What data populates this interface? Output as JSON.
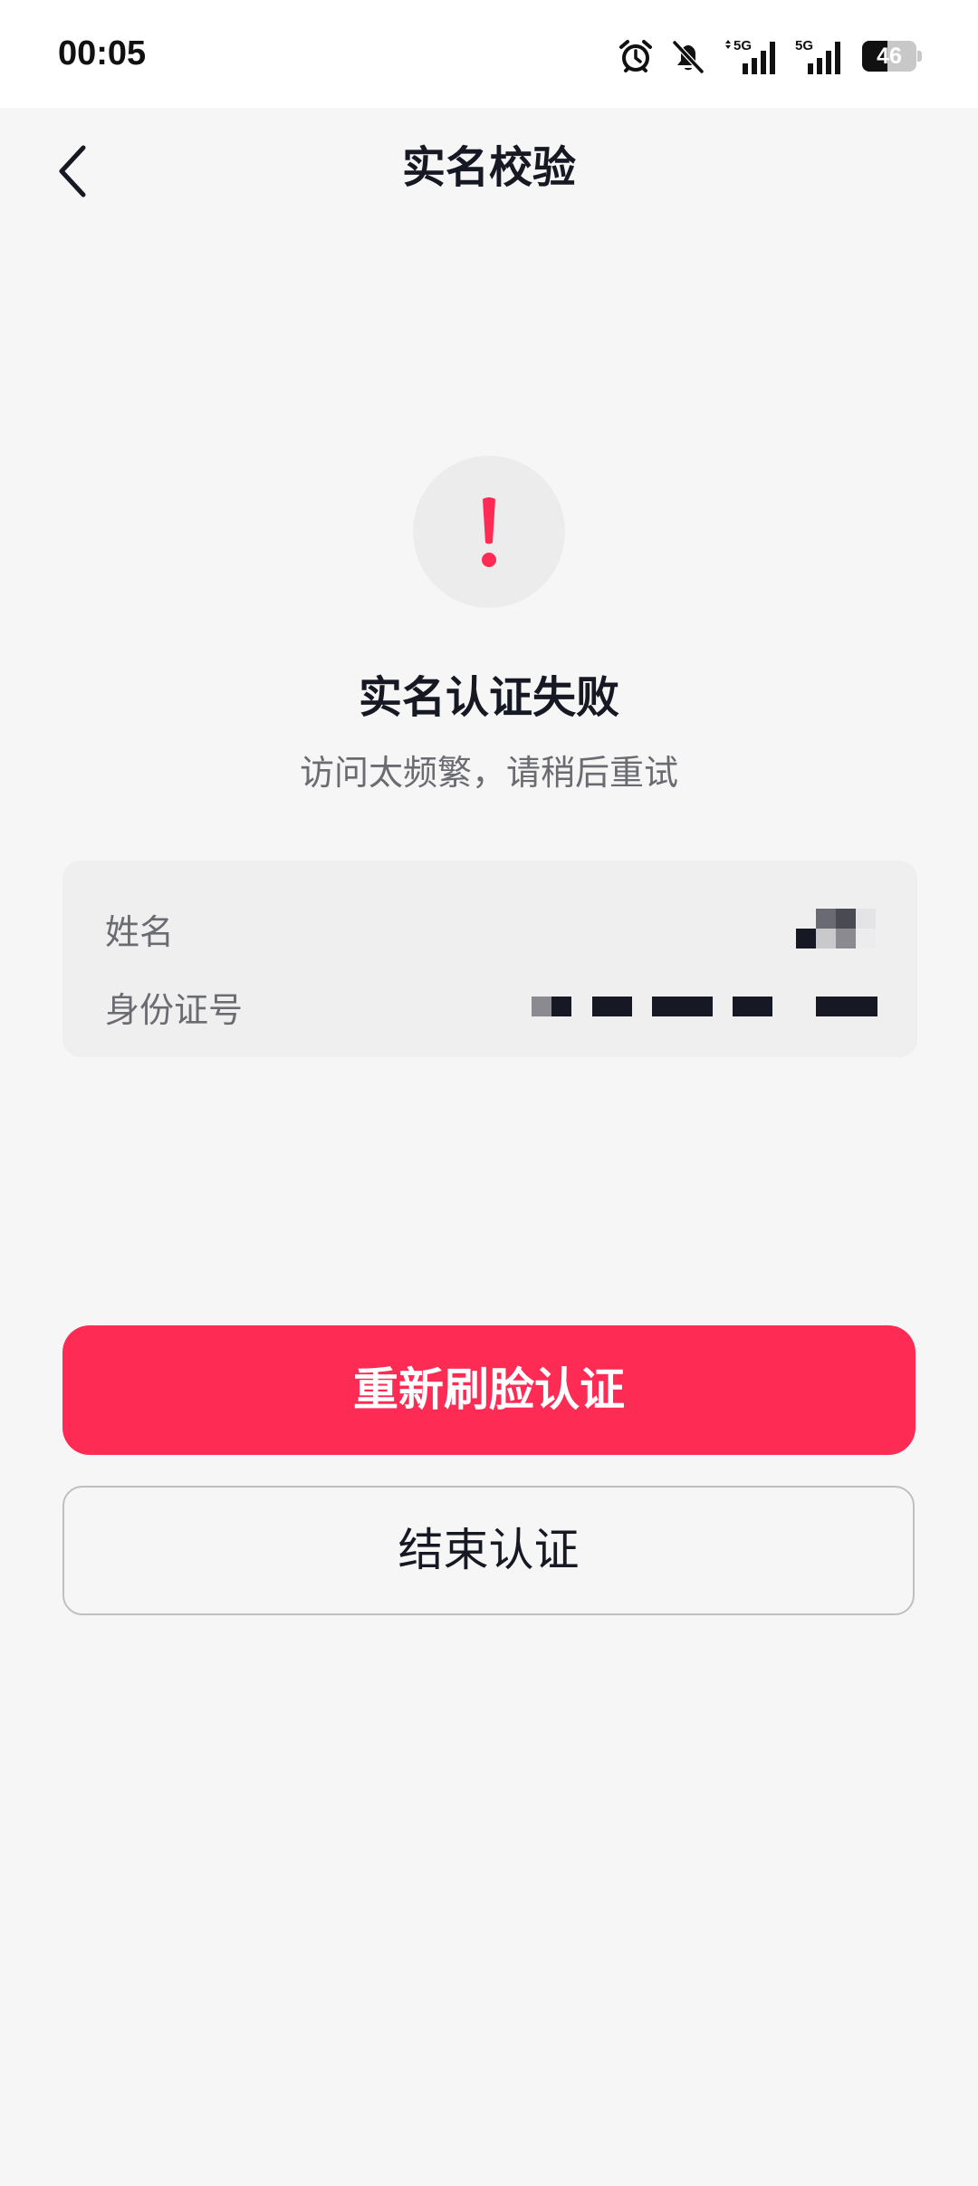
{
  "status_bar": {
    "time": "00:05",
    "battery_level": "46",
    "icons": [
      "alarm-icon",
      "bell-muted-icon",
      "signal-5g-icon",
      "signal-5g-icon",
      "battery-icon"
    ],
    "network_labels": [
      "5G",
      "5G"
    ]
  },
  "nav": {
    "title": "实名校验",
    "back_icon": "chevron-left-icon"
  },
  "result": {
    "icon": "exclamation-icon",
    "title": "实名认证失败",
    "subtitle": "访问太频繁，请稍后重试"
  },
  "info_card": {
    "rows": [
      {
        "label": "姓名",
        "value_masked": true
      },
      {
        "label": "身份证号",
        "value_masked": true
      }
    ]
  },
  "actions": {
    "primary_label": "重新刷脸认证",
    "secondary_label": "结束认证"
  },
  "colors": {
    "accent": "#fe2c55",
    "background": "#f6f6f6",
    "card": "#efeff0",
    "text_primary": "#161823",
    "text_secondary": "#6b6c72"
  }
}
